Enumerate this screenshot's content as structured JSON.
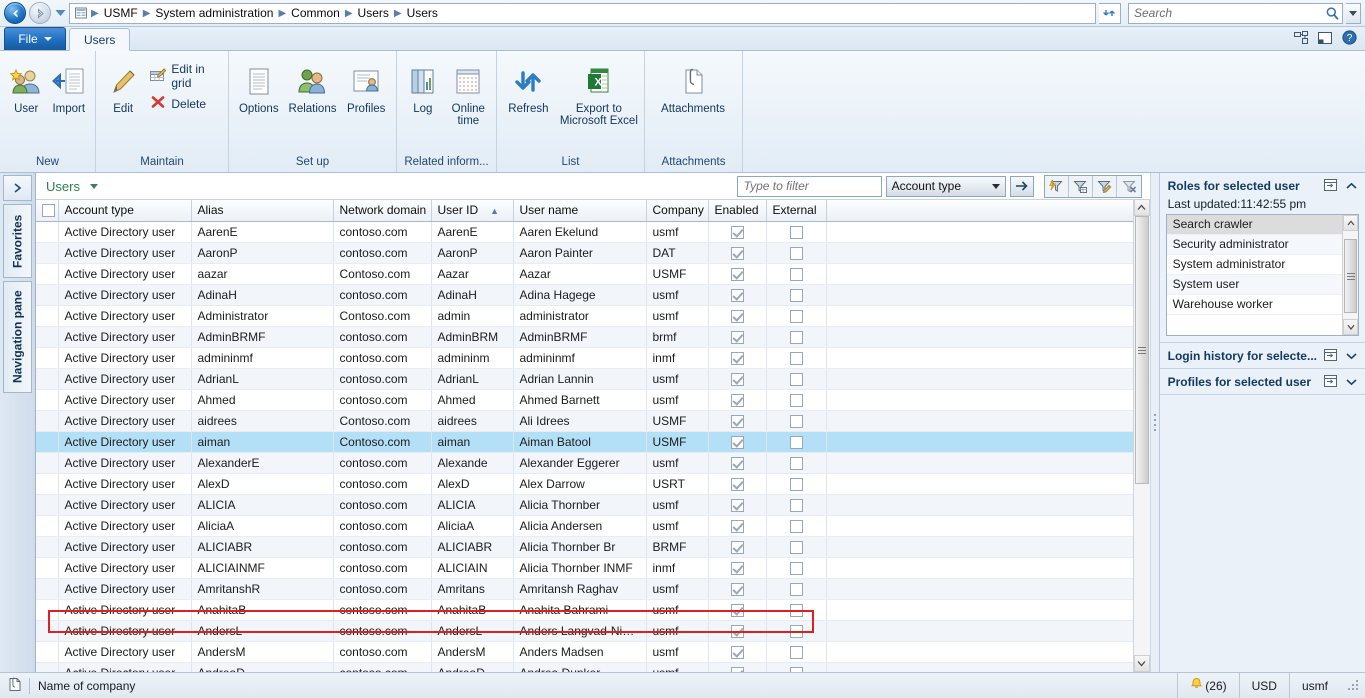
{
  "addressbar": {
    "back_icon": "back-arrow-icon",
    "forward_icon": "forward-arrow-icon",
    "history_icon": "history-dropdown-icon",
    "module_icon": "module-grid-icon",
    "breadcrumbs": [
      "USMF",
      "System administration",
      "Common",
      "Users",
      "Users"
    ],
    "refresh_icon": "refresh-icon",
    "search_placeholder": "Search",
    "search_value": "",
    "search_icon": "magnifier-icon",
    "search_dropdown_icon": "chevron-down-icon"
  },
  "tabs": {
    "file_label": "File",
    "items": [
      {
        "label": "Users",
        "active": true
      }
    ],
    "right_icons": [
      "window-layout-icon",
      "docking-pane-icon",
      "help-icon"
    ]
  },
  "ribbon": {
    "groups": [
      {
        "label": "New",
        "buttons": [
          {
            "label": "User",
            "icon": "new-user-icon",
            "style": "big"
          },
          {
            "label": "Import",
            "icon": "import-icon",
            "style": "big"
          }
        ]
      },
      {
        "label": "Maintain",
        "buttons": [
          {
            "label": "Edit",
            "icon": "pencil-edit-icon",
            "style": "big"
          },
          {
            "label": "Edit in grid",
            "icon": "edit-in-grid-icon",
            "style": "small"
          },
          {
            "label": "Delete",
            "icon": "delete-x-icon",
            "style": "small"
          }
        ]
      },
      {
        "label": "Set up",
        "buttons": [
          {
            "label": "Options",
            "icon": "options-icon",
            "style": "big"
          },
          {
            "label": "Relations",
            "icon": "relations-icon",
            "style": "big"
          },
          {
            "label": "Profiles",
            "icon": "profiles-icon",
            "style": "big"
          }
        ]
      },
      {
        "label": "Related inform...",
        "buttons": [
          {
            "label": "Log",
            "icon": "log-icon",
            "style": "big"
          },
          {
            "label": "Online time",
            "icon": "online-time-icon",
            "style": "big"
          }
        ]
      },
      {
        "label": "List",
        "buttons": [
          {
            "label": "Refresh",
            "icon": "refresh-arrows-icon",
            "style": "big"
          },
          {
            "label": "Export to Microsoft Excel",
            "icon": "excel-icon",
            "style": "big-wide"
          }
        ]
      },
      {
        "label": "Attachments",
        "buttons": [
          {
            "label": "Attachments",
            "icon": "paperclip-document-icon",
            "style": "big-wide"
          }
        ]
      }
    ]
  },
  "navpane": {
    "expand_icon": "chevron-right-icon",
    "favorites_label": "Favorites",
    "navigation_label": "Navigation pane"
  },
  "grid": {
    "caption": "Users",
    "caption_caret_icon": "chevron-down-icon",
    "filter_placeholder": "Type to filter",
    "filter_value": "",
    "filter_column": "Account type",
    "filter_go_icon": "arrow-right-icon",
    "filter_icons": [
      "advanced-filter-icon",
      "filter-by-grid-icon",
      "filter-by-selection-icon",
      "clear-filter-icon"
    ],
    "select_all_checkbox": false,
    "columns": [
      {
        "label": "Account type",
        "sorted": false
      },
      {
        "label": "Alias",
        "sorted": false
      },
      {
        "label": "Network domain",
        "sorted": false
      },
      {
        "label": "User ID",
        "sorted": true,
        "sort_dir": "asc"
      },
      {
        "label": "User name",
        "sorted": false
      },
      {
        "label": "Company",
        "sorted": false
      },
      {
        "label": "Enabled",
        "sorted": false
      },
      {
        "label": "External",
        "sorted": false
      }
    ],
    "rows": [
      {
        "account_type": "Active Directory user",
        "alias": "AarenE",
        "domain": "contoso.com",
        "user_id": "AarenE",
        "user_name": "Aaren Ekelund",
        "company": "usmf",
        "enabled": true,
        "external": false,
        "selected": false
      },
      {
        "account_type": "Active Directory user",
        "alias": "AaronP",
        "domain": "contoso.com",
        "user_id": "AaronP",
        "user_name": "Aaron Painter",
        "company": "DAT",
        "enabled": true,
        "external": false,
        "selected": false
      },
      {
        "account_type": "Active Directory user",
        "alias": "aazar",
        "domain": "Contoso.com",
        "user_id": "Aazar",
        "user_name": "Aazar",
        "company": "USMF",
        "enabled": true,
        "external": false,
        "selected": false
      },
      {
        "account_type": "Active Directory user",
        "alias": "AdinaH",
        "domain": "contoso.com",
        "user_id": "AdinaH",
        "user_name": "Adina Hagege",
        "company": "usmf",
        "enabled": true,
        "external": false,
        "selected": false
      },
      {
        "account_type": "Active Directory user",
        "alias": "Administrator",
        "domain": "Contoso.com",
        "user_id": "admin",
        "user_name": "administrator",
        "company": "usmf",
        "enabled": true,
        "external": false,
        "selected": false
      },
      {
        "account_type": "Active Directory user",
        "alias": "AdminBRMF",
        "domain": "contoso.com",
        "user_id": "AdminBRM",
        "user_name": "AdminBRMF",
        "company": "brmf",
        "enabled": true,
        "external": false,
        "selected": false
      },
      {
        "account_type": "Active Directory user",
        "alias": "admininmf",
        "domain": "contoso.com",
        "user_id": "admininm",
        "user_name": "admininmf",
        "company": "inmf",
        "enabled": true,
        "external": false,
        "selected": false
      },
      {
        "account_type": "Active Directory user",
        "alias": "AdrianL",
        "domain": "contoso.com",
        "user_id": "AdrianL",
        "user_name": "Adrian Lannin",
        "company": "usmf",
        "enabled": true,
        "external": false,
        "selected": false
      },
      {
        "account_type": "Active Directory user",
        "alias": "Ahmed",
        "domain": "contoso.com",
        "user_id": "Ahmed",
        "user_name": "Ahmed Barnett",
        "company": "usmf",
        "enabled": true,
        "external": false,
        "selected": false
      },
      {
        "account_type": "Active Directory user",
        "alias": "aidrees",
        "domain": "Contoso.com",
        "user_id": "aidrees",
        "user_name": "Ali Idrees",
        "company": "USMF",
        "enabled": true,
        "external": false,
        "selected": false
      },
      {
        "account_type": "Active Directory user",
        "alias": "aiman",
        "domain": "Contoso.com",
        "user_id": "aiman",
        "user_name": "Aiman Batool",
        "company": "USMF",
        "enabled": true,
        "external": false,
        "selected": true
      },
      {
        "account_type": "Active Directory user",
        "alias": "AlexanderE",
        "domain": "contoso.com",
        "user_id": "Alexande",
        "user_name": "Alexander Eggerer",
        "company": "usmf",
        "enabled": true,
        "external": false,
        "selected": false
      },
      {
        "account_type": "Active Directory user",
        "alias": "AlexD",
        "domain": "contoso.com",
        "user_id": "AlexD",
        "user_name": "Alex Darrow",
        "company": "USRT",
        "enabled": true,
        "external": false,
        "selected": false
      },
      {
        "account_type": "Active Directory user",
        "alias": "ALICIA",
        "domain": "contoso.com",
        "user_id": "ALICIA",
        "user_name": "Alicia Thornber",
        "company": "usmf",
        "enabled": true,
        "external": false,
        "selected": false
      },
      {
        "account_type": "Active Directory user",
        "alias": "AliciaA",
        "domain": "contoso.com",
        "user_id": "AliciaA",
        "user_name": "Alicia Andersen",
        "company": "usmf",
        "enabled": true,
        "external": false,
        "selected": false
      },
      {
        "account_type": "Active Directory user",
        "alias": "ALICIABR",
        "domain": "contoso.com",
        "user_id": "ALICIABR",
        "user_name": "Alicia Thornber Br",
        "company": "BRMF",
        "enabled": true,
        "external": false,
        "selected": false
      },
      {
        "account_type": "Active Directory user",
        "alias": "ALICIAINMF",
        "domain": "contoso.com",
        "user_id": "ALICIAIN",
        "user_name": "Alicia Thornber INMF",
        "company": "inmf",
        "enabled": true,
        "external": false,
        "selected": false
      },
      {
        "account_type": "Active Directory user",
        "alias": "AmritanshR",
        "domain": "contoso.com",
        "user_id": "Amritans",
        "user_name": "Amritansh Raghav",
        "company": "usmf",
        "enabled": true,
        "external": false,
        "selected": false
      },
      {
        "account_type": "Active Directory user",
        "alias": "AnahitaB",
        "domain": "contoso.com",
        "user_id": "AnahitaB",
        "user_name": "Anahita Bahrami",
        "company": "usmf",
        "enabled": true,
        "external": false,
        "selected": false
      },
      {
        "account_type": "Active Directory user",
        "alias": "AndersL",
        "domain": "contoso.com",
        "user_id": "AndersL",
        "user_name": "Anders Langvad-Niel...",
        "company": "usmf",
        "enabled": true,
        "external": false,
        "selected": false
      },
      {
        "account_type": "Active Directory user",
        "alias": "AndersM",
        "domain": "contoso.com",
        "user_id": "AndersM",
        "user_name": "Anders Madsen",
        "company": "usmf",
        "enabled": true,
        "external": false,
        "selected": false
      },
      {
        "account_type": "Active Directory user",
        "alias": "AndreaD",
        "domain": "contoso.com",
        "user_id": "AndreaD",
        "user_name": "Andrea Dunker",
        "company": "usmf",
        "enabled": true,
        "external": false,
        "selected": false
      }
    ]
  },
  "factboxes": {
    "roles": {
      "title": "Roles for selected user",
      "last_updated": "Last updated:11:42:55 pm",
      "expanded": true,
      "items": [
        {
          "label": "Search crawler",
          "selected": true
        },
        {
          "label": "Security administrator",
          "selected": false
        },
        {
          "label": "System administrator",
          "selected": false
        },
        {
          "label": "System user",
          "selected": false
        },
        {
          "label": "Warehouse worker",
          "selected": false
        }
      ]
    },
    "login_history": {
      "title": "Login history for selecte...",
      "expanded": false
    },
    "profiles": {
      "title": "Profiles for selected user",
      "expanded": false
    }
  },
  "statusbar": {
    "doc_icon": "document-icon",
    "message": "Name of company",
    "notifications": "(26)",
    "notification_icon": "bell-icon",
    "currency": "USD",
    "company": "usmf"
  },
  "colors": {
    "accent": "#1f6fc0",
    "selection": "#b3e0f7",
    "highlight_border": "#e02020",
    "caption_green": "#2e7d4f"
  }
}
